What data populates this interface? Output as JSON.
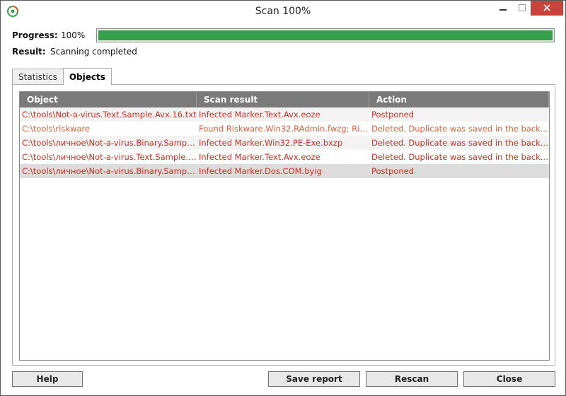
{
  "window": {
    "title": "Scan 100%",
    "close_color": "#c7443c"
  },
  "progress": {
    "label": "Progress:",
    "value_text": "100%",
    "percent": 100,
    "bar_color": "#35a14a"
  },
  "result": {
    "label": "Result:",
    "value": "Scanning completed"
  },
  "tabs": [
    {
      "label": "Statistics",
      "active": false
    },
    {
      "label": "Objects",
      "active": true
    }
  ],
  "table": {
    "columns": [
      "Object",
      "Scan result",
      "Action"
    ],
    "rows": [
      {
        "object": "C:\\tools\\Not-a-virus.Text.Sample.Avx.16.txt",
        "result": "Infected Marker.Text.Avx.eoze",
        "action": "Postponed",
        "color": "red"
      },
      {
        "object": "C:\\tools\\riskware",
        "result": "Found Riskware.Win32.RAdmin.fwzg; Risk…",
        "action": "Deleted. Duplicate was saved in the backu…",
        "color": "orange"
      },
      {
        "object": "C:\\tools\\личное\\Not-a-virus.Binary.Sample…",
        "result": "Infected Marker.Win32.PE-Exe.bxzp",
        "action": "Deleted. Duplicate was saved in the backu…",
        "color": "red"
      },
      {
        "object": "C:\\tools\\личное\\Not-a-virus.Text.Sample.…",
        "result": "Infected Marker.Text.Avx.eoze",
        "action": "Deleted. Duplicate was saved in the backu…",
        "color": "red"
      },
      {
        "object": "C:\\tools\\личное\\Not-a-virus.Binary.Sample…",
        "result": "Infected Marker.Dos.COM.byig",
        "action": "Postponed",
        "color": "red",
        "selected": true
      }
    ]
  },
  "buttons": {
    "help": "Help",
    "save_report": "Save report",
    "rescan": "Rescan",
    "close": "Close"
  },
  "icons": {
    "app": "antivirus-logo-icon",
    "minimize": "minimize-icon",
    "maximize": "maximize-icon",
    "close": "close-icon"
  }
}
